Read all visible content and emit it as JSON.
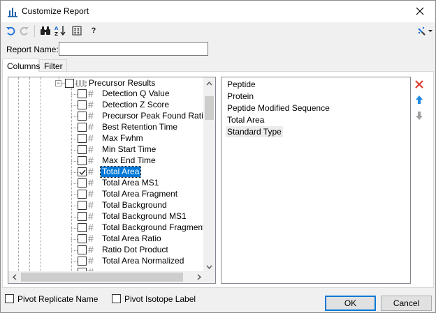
{
  "window": {
    "title": "Customize Report"
  },
  "toolbar": {
    "undo_icon": "undo-icon",
    "redo_icon": "redo-icon",
    "find_icon": "binoculars-icon",
    "sort_icon": "sort-az-icon",
    "columns_icon": "column-grid-icon",
    "help_label": "?",
    "menu_icon": "wand-dropdown-icon"
  },
  "report_name": {
    "label": "Report Name:",
    "value": "",
    "placeholder": ""
  },
  "tabs": [
    {
      "label": "Columns",
      "active": true
    },
    {
      "label": "Filter",
      "active": false
    }
  ],
  "tree": {
    "parent": {
      "label": "Precursor Results",
      "checked": false,
      "expanded": true
    },
    "items": [
      {
        "label": "Detection Q Value",
        "checked": false,
        "selected": false
      },
      {
        "label": "Detection Z Score",
        "checked": false,
        "selected": false
      },
      {
        "label": "Precursor Peak Found Ratio",
        "checked": false,
        "selected": false
      },
      {
        "label": "Best Retention Time",
        "checked": false,
        "selected": false
      },
      {
        "label": "Max Fwhm",
        "checked": false,
        "selected": false
      },
      {
        "label": "Min Start Time",
        "checked": false,
        "selected": false
      },
      {
        "label": "Max End Time",
        "checked": false,
        "selected": false
      },
      {
        "label": "Total Area",
        "checked": true,
        "selected": true
      },
      {
        "label": "Total Area MS1",
        "checked": false,
        "selected": false
      },
      {
        "label": "Total Area Fragment",
        "checked": false,
        "selected": false
      },
      {
        "label": "Total Background",
        "checked": false,
        "selected": false
      },
      {
        "label": "Total Background MS1",
        "checked": false,
        "selected": false
      },
      {
        "label": "Total Background Fragment",
        "checked": false,
        "selected": false
      },
      {
        "label": "Total Area Ratio",
        "checked": false,
        "selected": false
      },
      {
        "label": "Ratio Dot Product",
        "checked": false,
        "selected": false
      },
      {
        "label": "Total Area Normalized",
        "checked": false,
        "selected": false
      }
    ]
  },
  "columns_list": [
    {
      "label": "Peptide",
      "highlighted": false
    },
    {
      "label": "Protein",
      "highlighted": false
    },
    {
      "label": "Peptide Modified Sequence",
      "highlighted": false
    },
    {
      "label": "Total Area",
      "highlighted": false
    },
    {
      "label": "Standard Type",
      "highlighted": true
    }
  ],
  "side_buttons": {
    "remove_icon": "red-x-icon",
    "up_icon": "arrow-up-icon",
    "down_icon": "arrow-down-icon"
  },
  "options": {
    "pivot_replicate": {
      "label": "Pivot Replicate Name",
      "checked": false
    },
    "pivot_isotope": {
      "label": "Pivot Isotope Label",
      "checked": false
    }
  },
  "buttons": {
    "ok": "OK",
    "cancel": "Cancel"
  },
  "colors": {
    "selection": "#0078d7",
    "remove": "#e03c31",
    "move_up": "#1e88e5",
    "move_down": "#a0a0a0"
  }
}
